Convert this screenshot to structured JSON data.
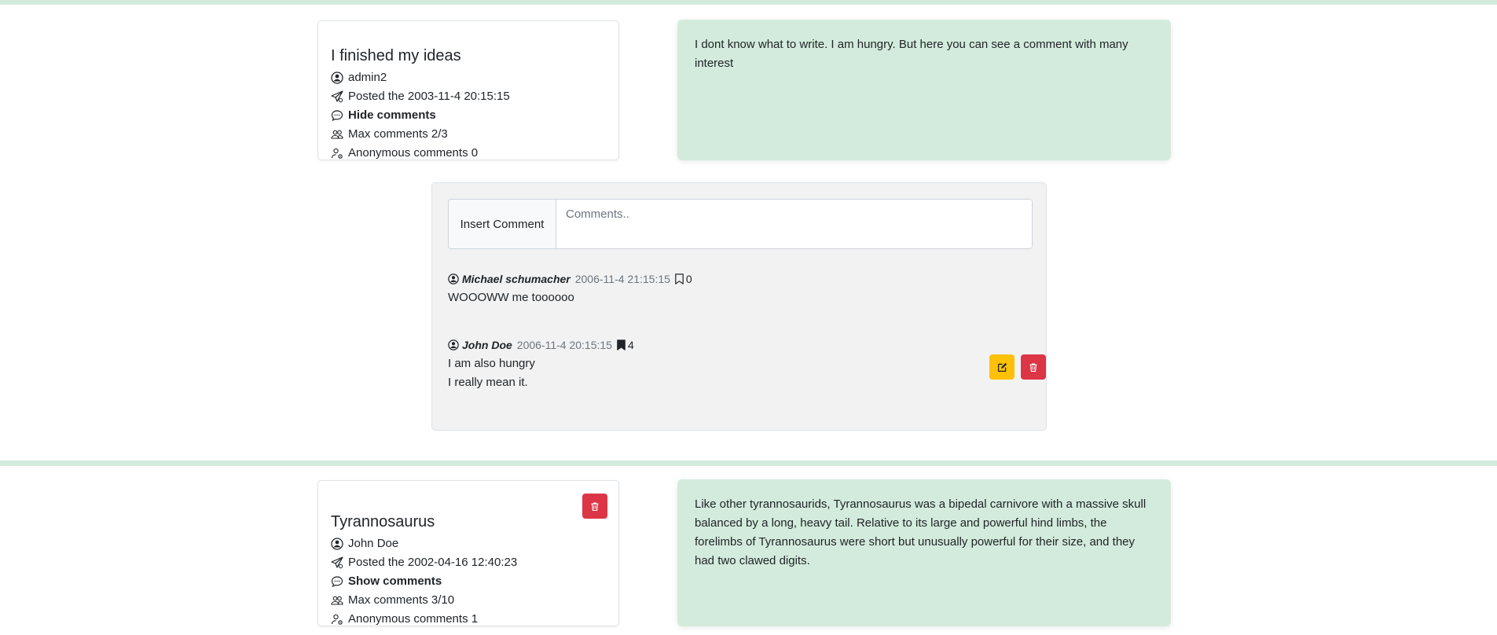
{
  "posts": [
    {
      "title": "I finished my ideas",
      "author": "admin2",
      "posted": "Posted the 2003-11-4 20:15:15",
      "toggle_comments": "Hide comments",
      "max_comments": "Max comments 2/3",
      "anonymous_comments": "Anonymous comments 0",
      "body": "I dont know what to write. I am hungry. But here you can see a comment with many interest"
    },
    {
      "title": "Tyrannosaurus",
      "author": "John Doe",
      "posted": "Posted the 2002-04-16 12:40:23",
      "toggle_comments": "Show comments",
      "max_comments": "Max comments 3/10",
      "anonymous_comments": "Anonymous comments 1",
      "body": "Like other tyrannosaurids, Tyrannosaurus was a bipedal carnivore with a massive skull balanced by a long, heavy tail. Relative to its large and powerful hind limbs, the forelimbs of Tyrannosaurus were short but unusually powerful for their size, and they had two clawed digits."
    }
  ],
  "comment_form": {
    "label": "Insert Comment",
    "placeholder": "Comments.."
  },
  "comments": [
    {
      "author": "Michael schumacher",
      "date": "2006-11-4 21:15:15",
      "bookmarks": "0",
      "bookmarked": false,
      "lines": [
        "WOOOWW me toooooo"
      ]
    },
    {
      "author": "John Doe",
      "date": "2006-11-4 20:15:15",
      "bookmarks": "4",
      "bookmarked": true,
      "lines": [
        "I am also hungry",
        "I really mean it."
      ]
    }
  ],
  "colors": {
    "accent_green": "#d3ebdc",
    "danger": "#dc3545",
    "warning": "#ffc107"
  },
  "icons": {
    "author": "person-circle-icon",
    "posted": "send-icon",
    "comments": "chat-icon",
    "max": "people-icon",
    "anonymous": "person-gear-icon",
    "bookmark": "bookmark-icon",
    "edit": "pencil-square-icon",
    "delete": "trash-icon"
  }
}
